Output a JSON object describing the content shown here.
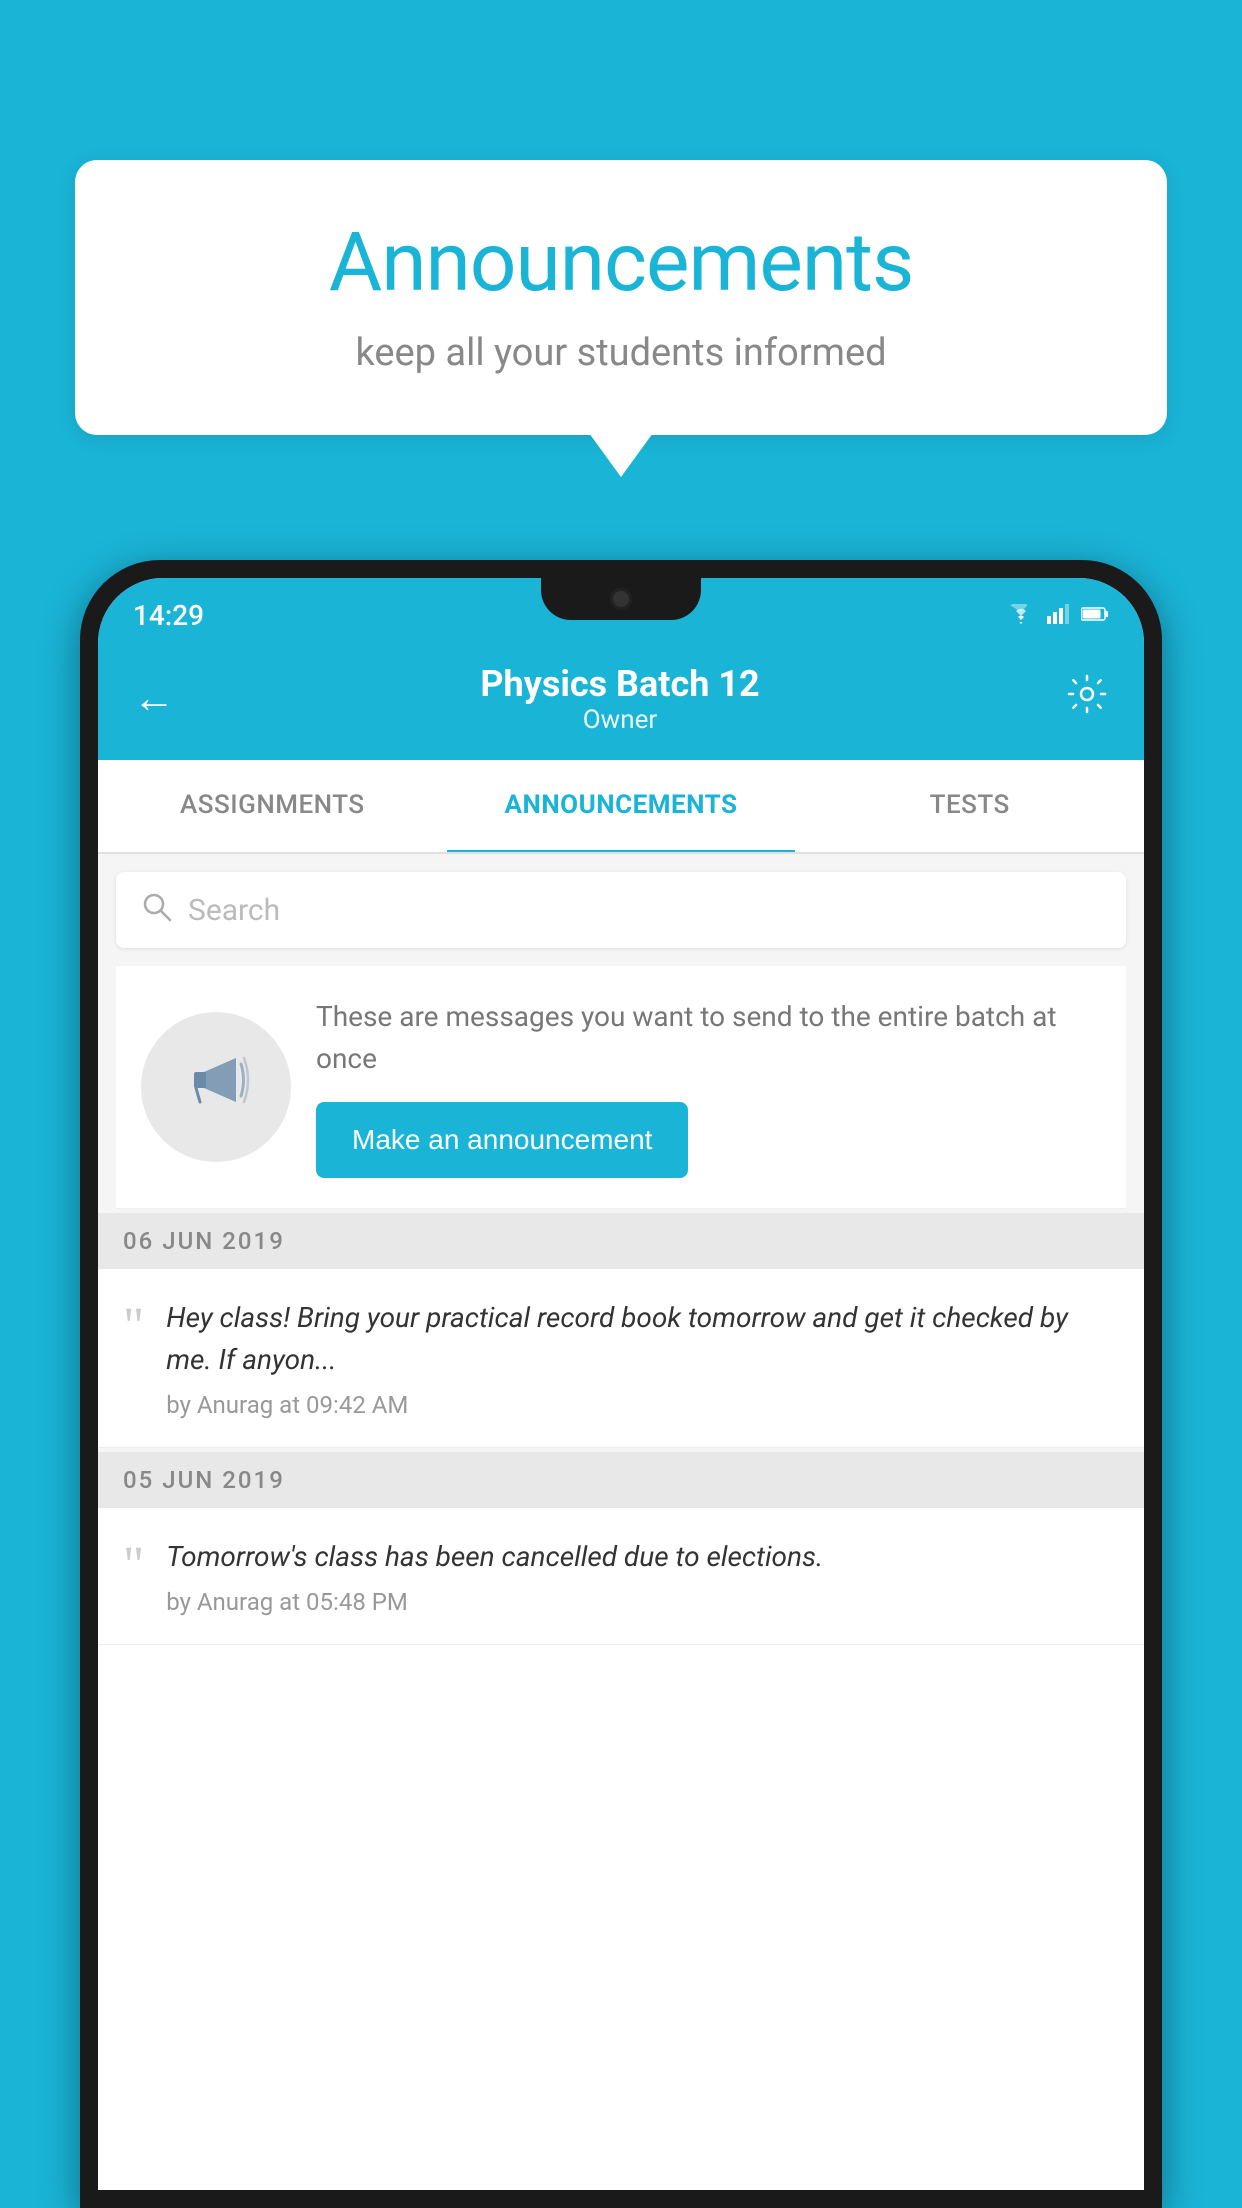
{
  "background_color": "#1ab4d7",
  "bubble": {
    "title": "Announcements",
    "subtitle": "keep all your students informed"
  },
  "phone": {
    "status_bar": {
      "time": "14:29",
      "wifi": "▾",
      "signal": "▲",
      "battery": "▮"
    },
    "header": {
      "title": "Physics Batch 12",
      "subtitle": "Owner",
      "back_label": "←",
      "settings_label": "⚙"
    },
    "tabs": [
      {
        "label": "ASSIGNMENTS",
        "active": false
      },
      {
        "label": "ANNOUNCEMENTS",
        "active": true
      },
      {
        "label": "TESTS",
        "active": false
      }
    ],
    "search": {
      "placeholder": "Search"
    },
    "promo": {
      "text": "These are messages you want to send to the entire batch at once",
      "button_label": "Make an announcement"
    },
    "date_sections": [
      {
        "date": "06  JUN  2019",
        "announcements": [
          {
            "text": "Hey class! Bring your practical record book tomorrow and get it checked by me. If anyon...",
            "meta": "by Anurag at 09:42 AM"
          }
        ]
      },
      {
        "date": "05  JUN  2019",
        "announcements": [
          {
            "text": "Tomorrow's class has been cancelled due to elections.",
            "meta": "by Anurag at 05:48 PM"
          }
        ]
      }
    ]
  }
}
